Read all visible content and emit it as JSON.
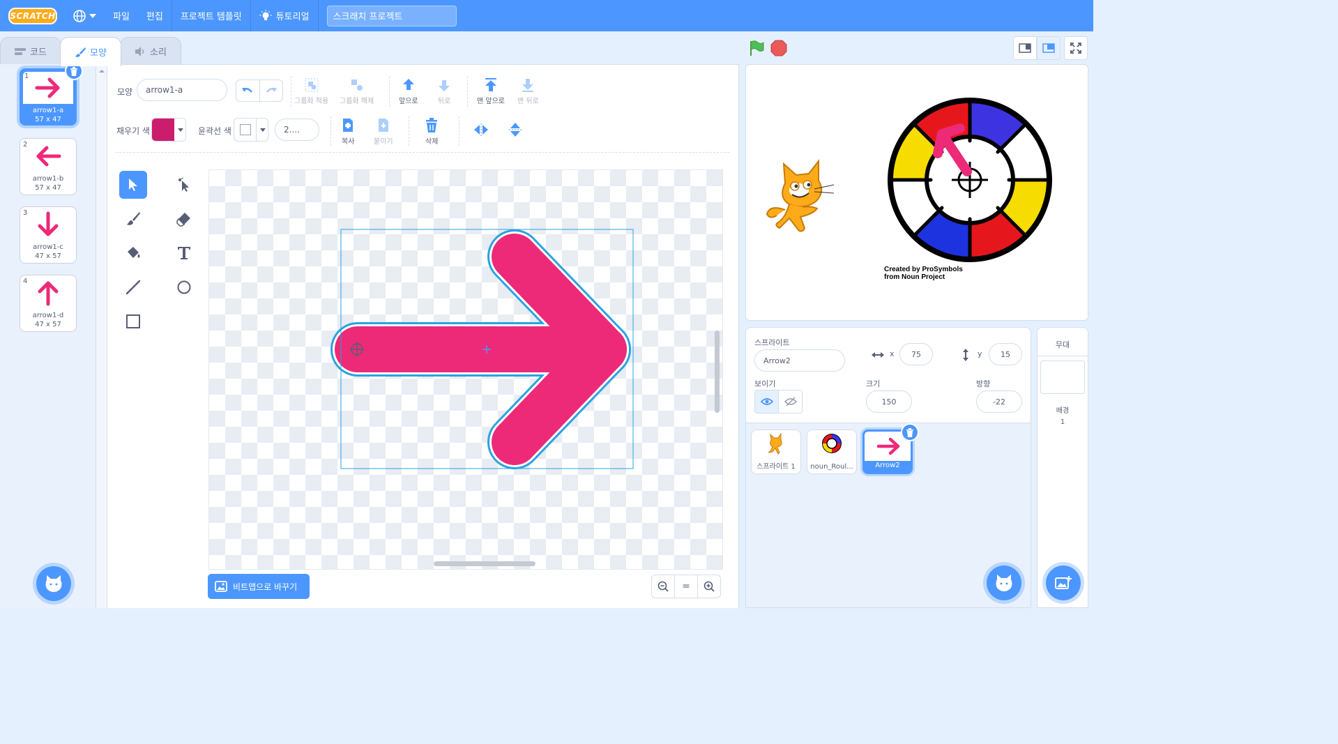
{
  "menu": {
    "logo": "SCRATCH",
    "file": "파일",
    "edit": "편집",
    "templates": "프로젝트 템플릿",
    "tutorials": "튜토리얼",
    "project_title": "스크래치 프로젝트"
  },
  "tabs": [
    {
      "label": "코드",
      "icon": "code-icon"
    },
    {
      "label": "모양",
      "icon": "brush-icon"
    },
    {
      "label": "소리",
      "icon": "speaker-icon"
    }
  ],
  "costumes": [
    {
      "num": "1",
      "name": "arrow1-a",
      "size": "57 x 47",
      "direction": "right",
      "selected": true
    },
    {
      "num": "2",
      "name": "arrow1-b",
      "size": "57 x 47",
      "direction": "left",
      "selected": false
    },
    {
      "num": "3",
      "name": "arrow1-c",
      "size": "47 x 57",
      "direction": "down",
      "selected": false
    },
    {
      "num": "4",
      "name": "arrow1-d",
      "size": "47 x 57",
      "direction": "up",
      "selected": false
    }
  ],
  "editor": {
    "costume_label": "모양",
    "costume_name": "arrow1-a",
    "group": "그룹화 적용",
    "ungroup": "그룹화 해제",
    "forward": "앞으로",
    "backward": "뒤로",
    "front": "맨 앞으로",
    "back": "맨 뒤로",
    "fill_label": "채우기 색",
    "outline_label": "윤곽선 색",
    "outline_width": "2....",
    "copy": "복사",
    "paste": "붙이기",
    "delete": "삭제",
    "convert_bitmap": "비트맵으로 바꾸기",
    "zoom_reset": "=",
    "fill_color": "#cc1d6d",
    "arrow_color": "#ec2a78"
  },
  "stage": {
    "credit_line1": "Created by ProSymbols",
    "credit_line2": "from Noun Project"
  },
  "sprite_info": {
    "sprite_label": "스프라이트",
    "sprite_name": "Arrow2",
    "x_label": "x",
    "x": "75",
    "y_label": "y",
    "y": "15",
    "show_label": "보이기",
    "size_label": "크기",
    "size": "150",
    "direction_label": "방향",
    "direction": "-22"
  },
  "sprites": [
    {
      "name": "스프라이트 1"
    },
    {
      "name": "noun_Roul..."
    },
    {
      "name": "Arrow2"
    }
  ],
  "stage_panel": {
    "title": "무대",
    "backdrops_label": "배경",
    "backdrops_count": "1"
  }
}
